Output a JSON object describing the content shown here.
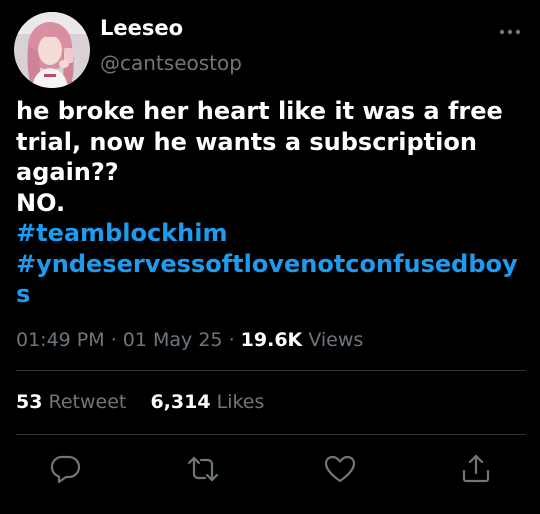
{
  "tweet": {
    "display_name": "Leeseo",
    "handle": "@cantseostop",
    "text_lines": [
      "he broke her heart like it was a free",
      "trial, now he wants a subscription",
      "again??",
      "NO."
    ],
    "hashtags": [
      "#teamblockhim",
      "#yndeservessoftlovenotconfusedboy",
      "s"
    ],
    "time": "01:49 PM",
    "date": "01 May 25",
    "views_count": "19.6K",
    "views_label": "Views",
    "retweets_count": "53",
    "retweets_label": "Retweet",
    "likes_count": "6,314",
    "likes_label": "Likes"
  },
  "icons": {
    "more": "more-horizontal-icon",
    "reply": "reply-icon",
    "retweet": "retweet-icon",
    "like": "heart-icon",
    "share": "share-icon"
  },
  "colors": {
    "background": "#000000",
    "text": "#ffffff",
    "secondary": "#6e767d",
    "hashtag": "#1d9bf0",
    "divider": "#2f3336"
  }
}
